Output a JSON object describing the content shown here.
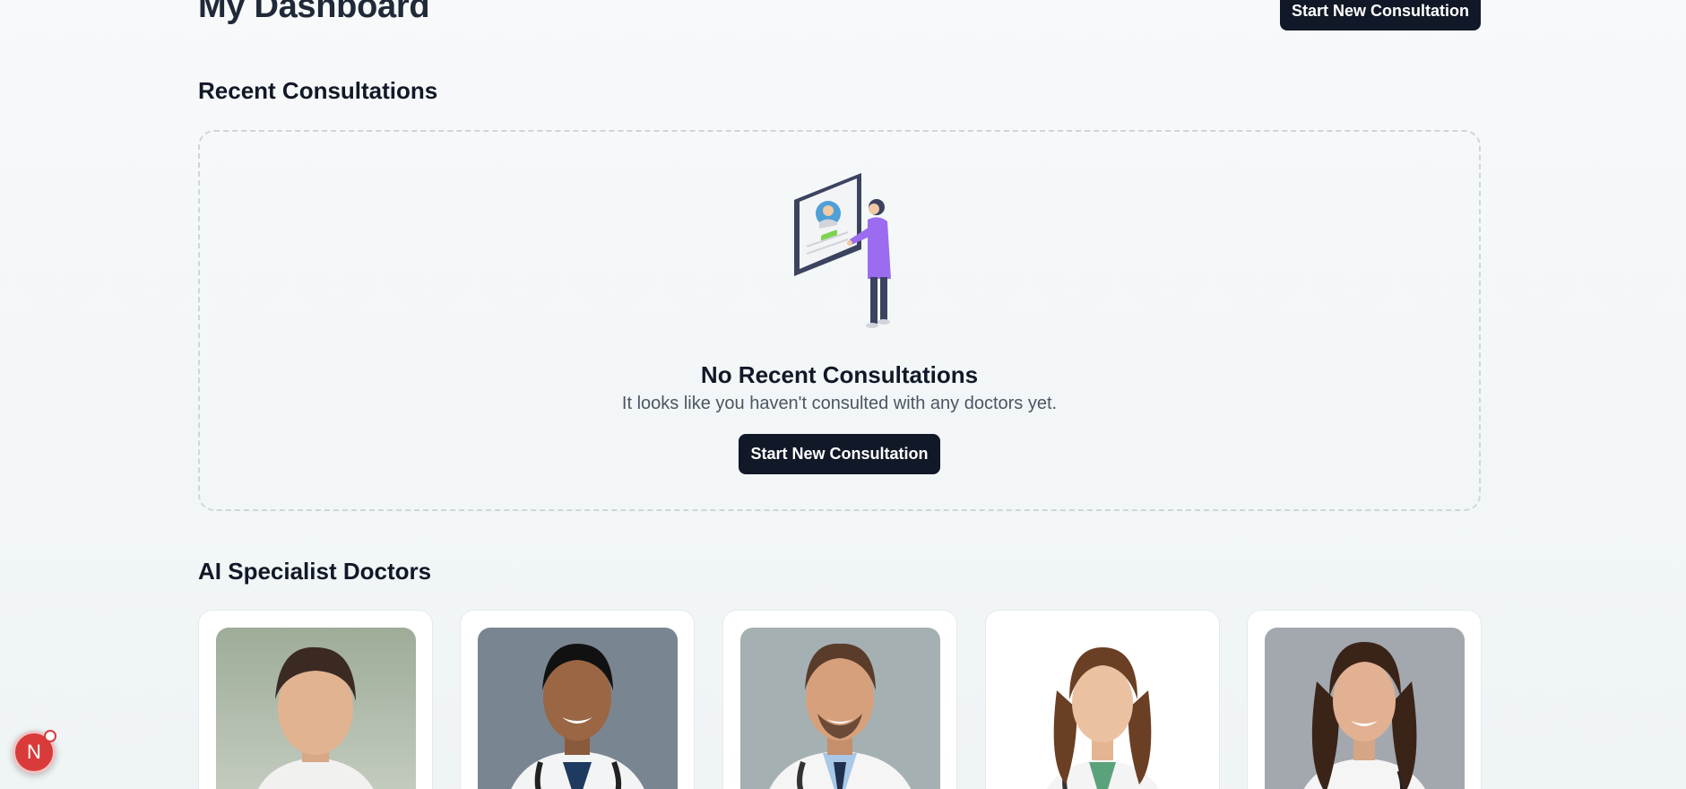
{
  "header": {
    "title": "My Dashboard",
    "start_button": "Start New Consultation"
  },
  "recent": {
    "title": "Recent Consultations",
    "empty_heading": "No Recent Consultations",
    "empty_text": "It looks like you haven't consulted with any doctors yet.",
    "empty_button": "Start New Consultation"
  },
  "doctors": {
    "title": "AI Specialist Doctors"
  },
  "dev_badge": {
    "letter": "N"
  },
  "colors": {
    "primary": "#111827",
    "badge": "#d93b3b"
  }
}
